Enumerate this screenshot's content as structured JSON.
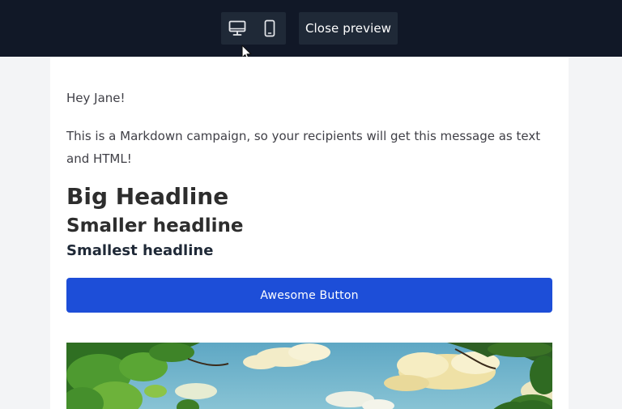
{
  "preview_toolbar": {
    "desktop_icon": "monitor-icon",
    "mobile_icon": "smartphone-icon",
    "close_label": "Close preview"
  },
  "email": {
    "greeting": "Hey Jane!",
    "intro": "This is a Markdown campaign, so your recipients will get this message as text and HTML!",
    "heading_1": "Big Headline",
    "heading_2": "Smaller headline",
    "heading_3": "Smallest headline",
    "button_label": "Awesome Button",
    "image_subject": "sky-with-clouds-and-trees-illustration"
  },
  "colors": {
    "toolbar_bg": "#111827",
    "button_bg": "#1d4ed8",
    "page_bg": "#f3f4f6"
  }
}
